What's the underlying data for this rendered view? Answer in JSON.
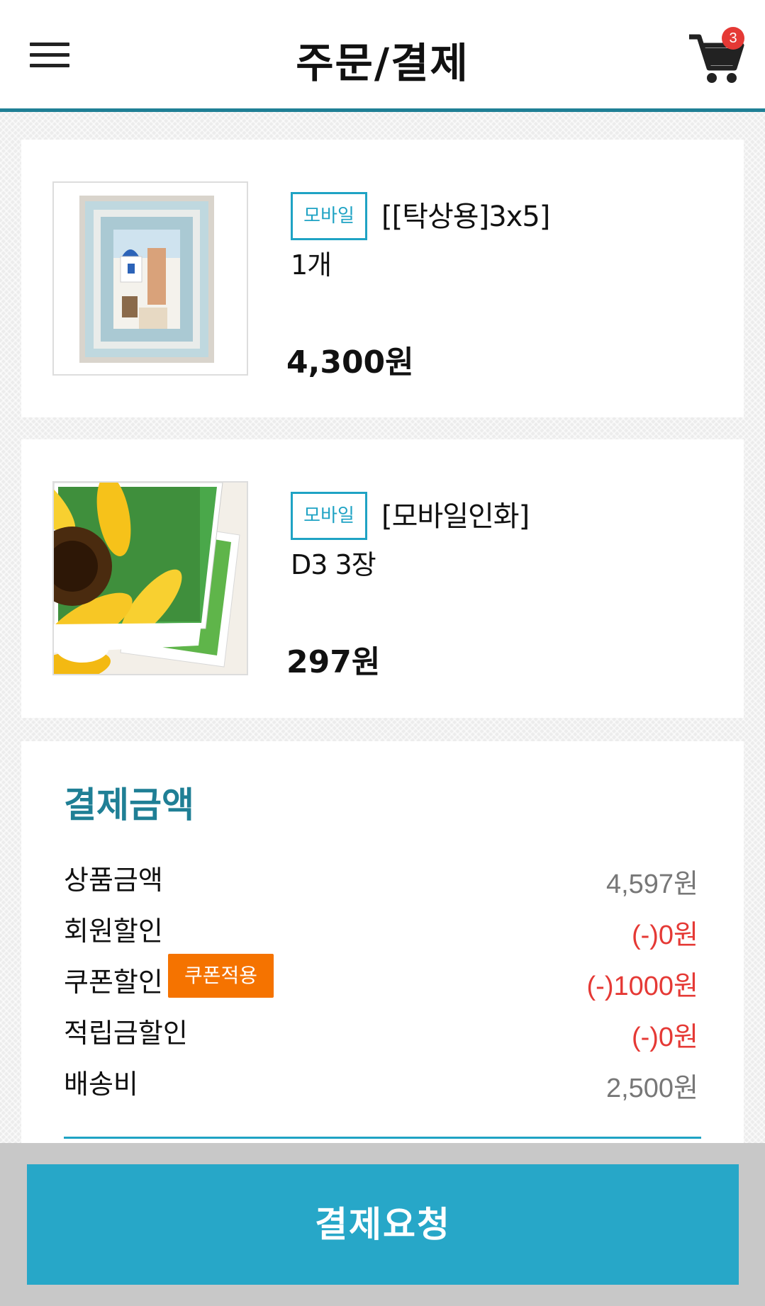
{
  "header": {
    "title": "주문/결제",
    "cart_count": "3"
  },
  "items": [
    {
      "tag": "모바일",
      "name": "[[탁상용]3x5]",
      "qty": "1개",
      "price": "4,300원",
      "image": "blue-picture-frame"
    },
    {
      "tag": "모바일",
      "name": "[모바일인화]",
      "qty": "D3 3장",
      "price": "297원",
      "image": "sunflower-photo-prints"
    }
  ],
  "summary": {
    "title": "결제금액",
    "rows": [
      {
        "label": "상품금액",
        "value": "4,597원"
      },
      {
        "label": "회원할인",
        "value": "(-)0원"
      },
      {
        "label": "쿠폰할인",
        "value": "(-)1000원"
      },
      {
        "label": "적립금할인",
        "value": "(-)0원"
      },
      {
        "label": "배송비",
        "value": "2,500원"
      }
    ],
    "coupon_button": "쿠폰적용"
  },
  "pay_button": "결제요청",
  "colors": {
    "accent": "#1f7f95",
    "button": "#27a7c8",
    "coupon": "#f57300",
    "discount": "#e53935"
  }
}
